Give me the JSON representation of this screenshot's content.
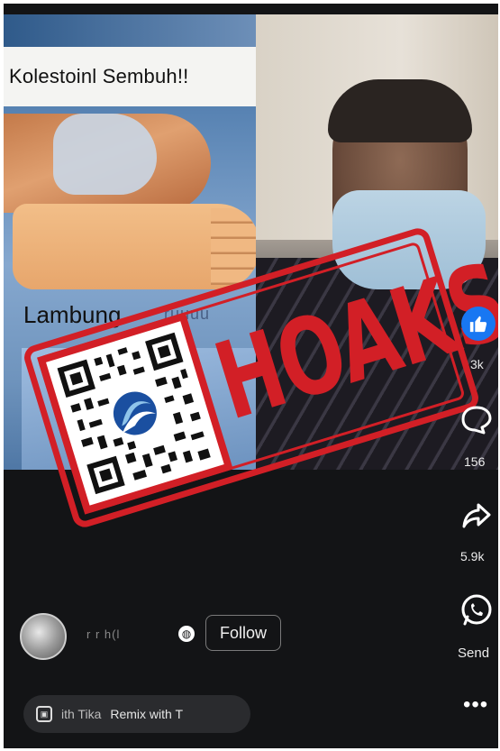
{
  "left_video": {
    "caption": "Kolestoinl Sembuh!!",
    "label_main": "Lambung",
    "label_faded": "ruuuu"
  },
  "stamp": {
    "word": "HOAKS",
    "color": "#d21f26"
  },
  "actions": {
    "like_icon": "thumbs-up-icon",
    "like_count": "3k",
    "comment_icon": "comment-bubble-icon",
    "comment_count": "156",
    "share_icon": "share-arrow-icon",
    "share_count": "5.9k",
    "send_icon": "whatsapp-icon",
    "send_label": "Send",
    "more_icon": "more-dots-icon",
    "more_label": "•••"
  },
  "author": {
    "username": "r r h(l",
    "visibility_icon": "globe-icon",
    "follow_label": "Follow"
  },
  "remix_bar": {
    "icon": "remix-icon",
    "item1": "ith Tika",
    "item2": "Remix with T"
  },
  "colors": {
    "background": "#131416",
    "like_blue": "#1877f2",
    "stamp_red": "#d21f26"
  }
}
